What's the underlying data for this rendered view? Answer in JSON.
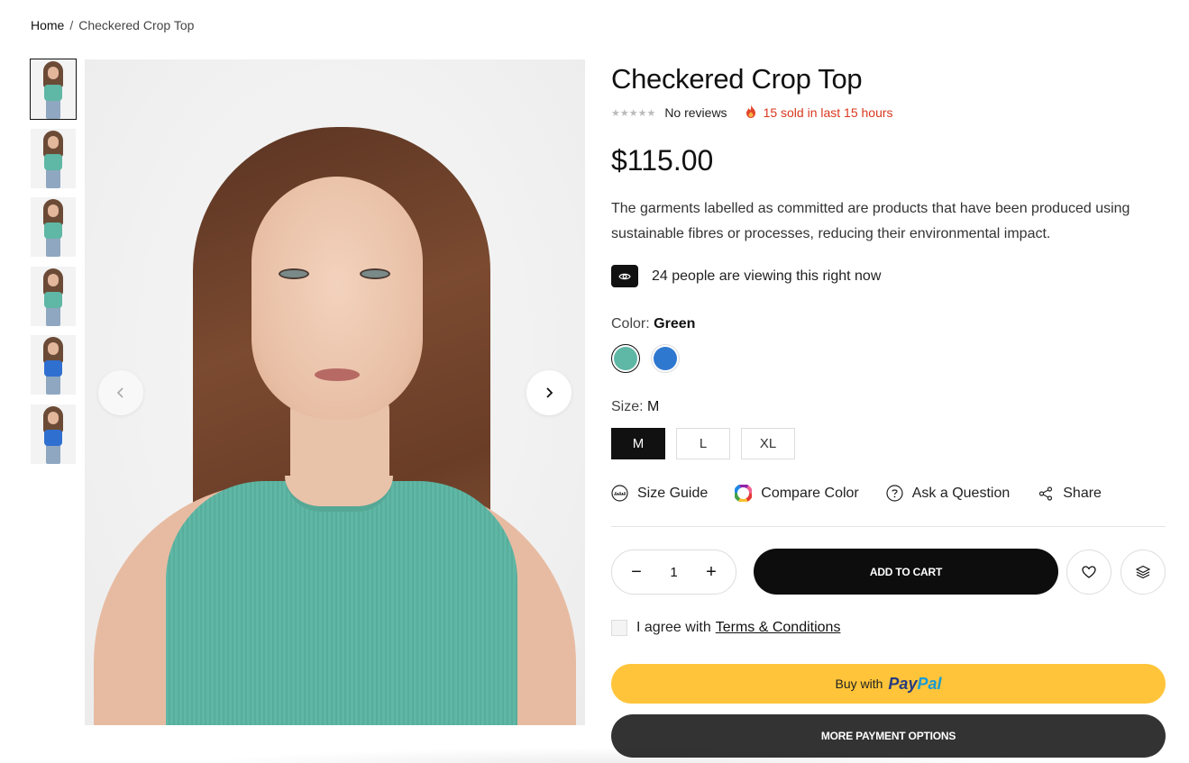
{
  "breadcrumb": {
    "home": "Home",
    "separator": "/",
    "current": "Checkered Crop Top"
  },
  "gallery": {
    "thumbnails": [
      {
        "top_color": "#5fb7a5",
        "active": true
      },
      {
        "top_color": "#5fb7a5",
        "active": false
      },
      {
        "top_color": "#5fb7a5",
        "active": false
      },
      {
        "top_color": "#5fb7a5",
        "active": false
      },
      {
        "top_color": "#2f6fd0",
        "active": false
      },
      {
        "top_color": "#2f6fd0",
        "active": false
      }
    ],
    "prev_icon": "chevron-left-icon",
    "next_icon": "chevron-right-icon"
  },
  "product": {
    "title": "Checkered Crop Top",
    "rating_stars": "★★★★★",
    "reviews": "No reviews",
    "sold": "15 sold in last 15 hours",
    "price": "$115.00",
    "description": "The garments labelled as committed are products that have been produced using sustainable fibres or processes, reducing their environmental impact.",
    "viewing": "24 people are viewing this right now",
    "color_label": "Color:",
    "color_value": "Green",
    "colors": [
      {
        "name": "Green",
        "hex": "#5fb7a5",
        "active": true
      },
      {
        "name": "Blue",
        "hex": "#2f78d0",
        "active": false
      }
    ],
    "size_label": "Size:",
    "size_value": "M",
    "sizes": [
      {
        "label": "M",
        "active": true
      },
      {
        "label": "L",
        "active": false
      },
      {
        "label": "XL",
        "active": false
      }
    ]
  },
  "links": {
    "size_guide": "Size Guide",
    "compare_color": "Compare Color",
    "ask_question": "Ask a Question",
    "share": "Share"
  },
  "cart": {
    "quantity": "1",
    "minus": "−",
    "plus": "+",
    "add_to_cart": "ADD TO CART"
  },
  "agree": {
    "text": "I agree with",
    "terms": "Terms & Conditions"
  },
  "payment": {
    "buy_with": "Buy with",
    "paypal_pay": "Pay",
    "paypal_pal": "Pal",
    "more_options": "MORE PAYMENT OPTIONS"
  }
}
